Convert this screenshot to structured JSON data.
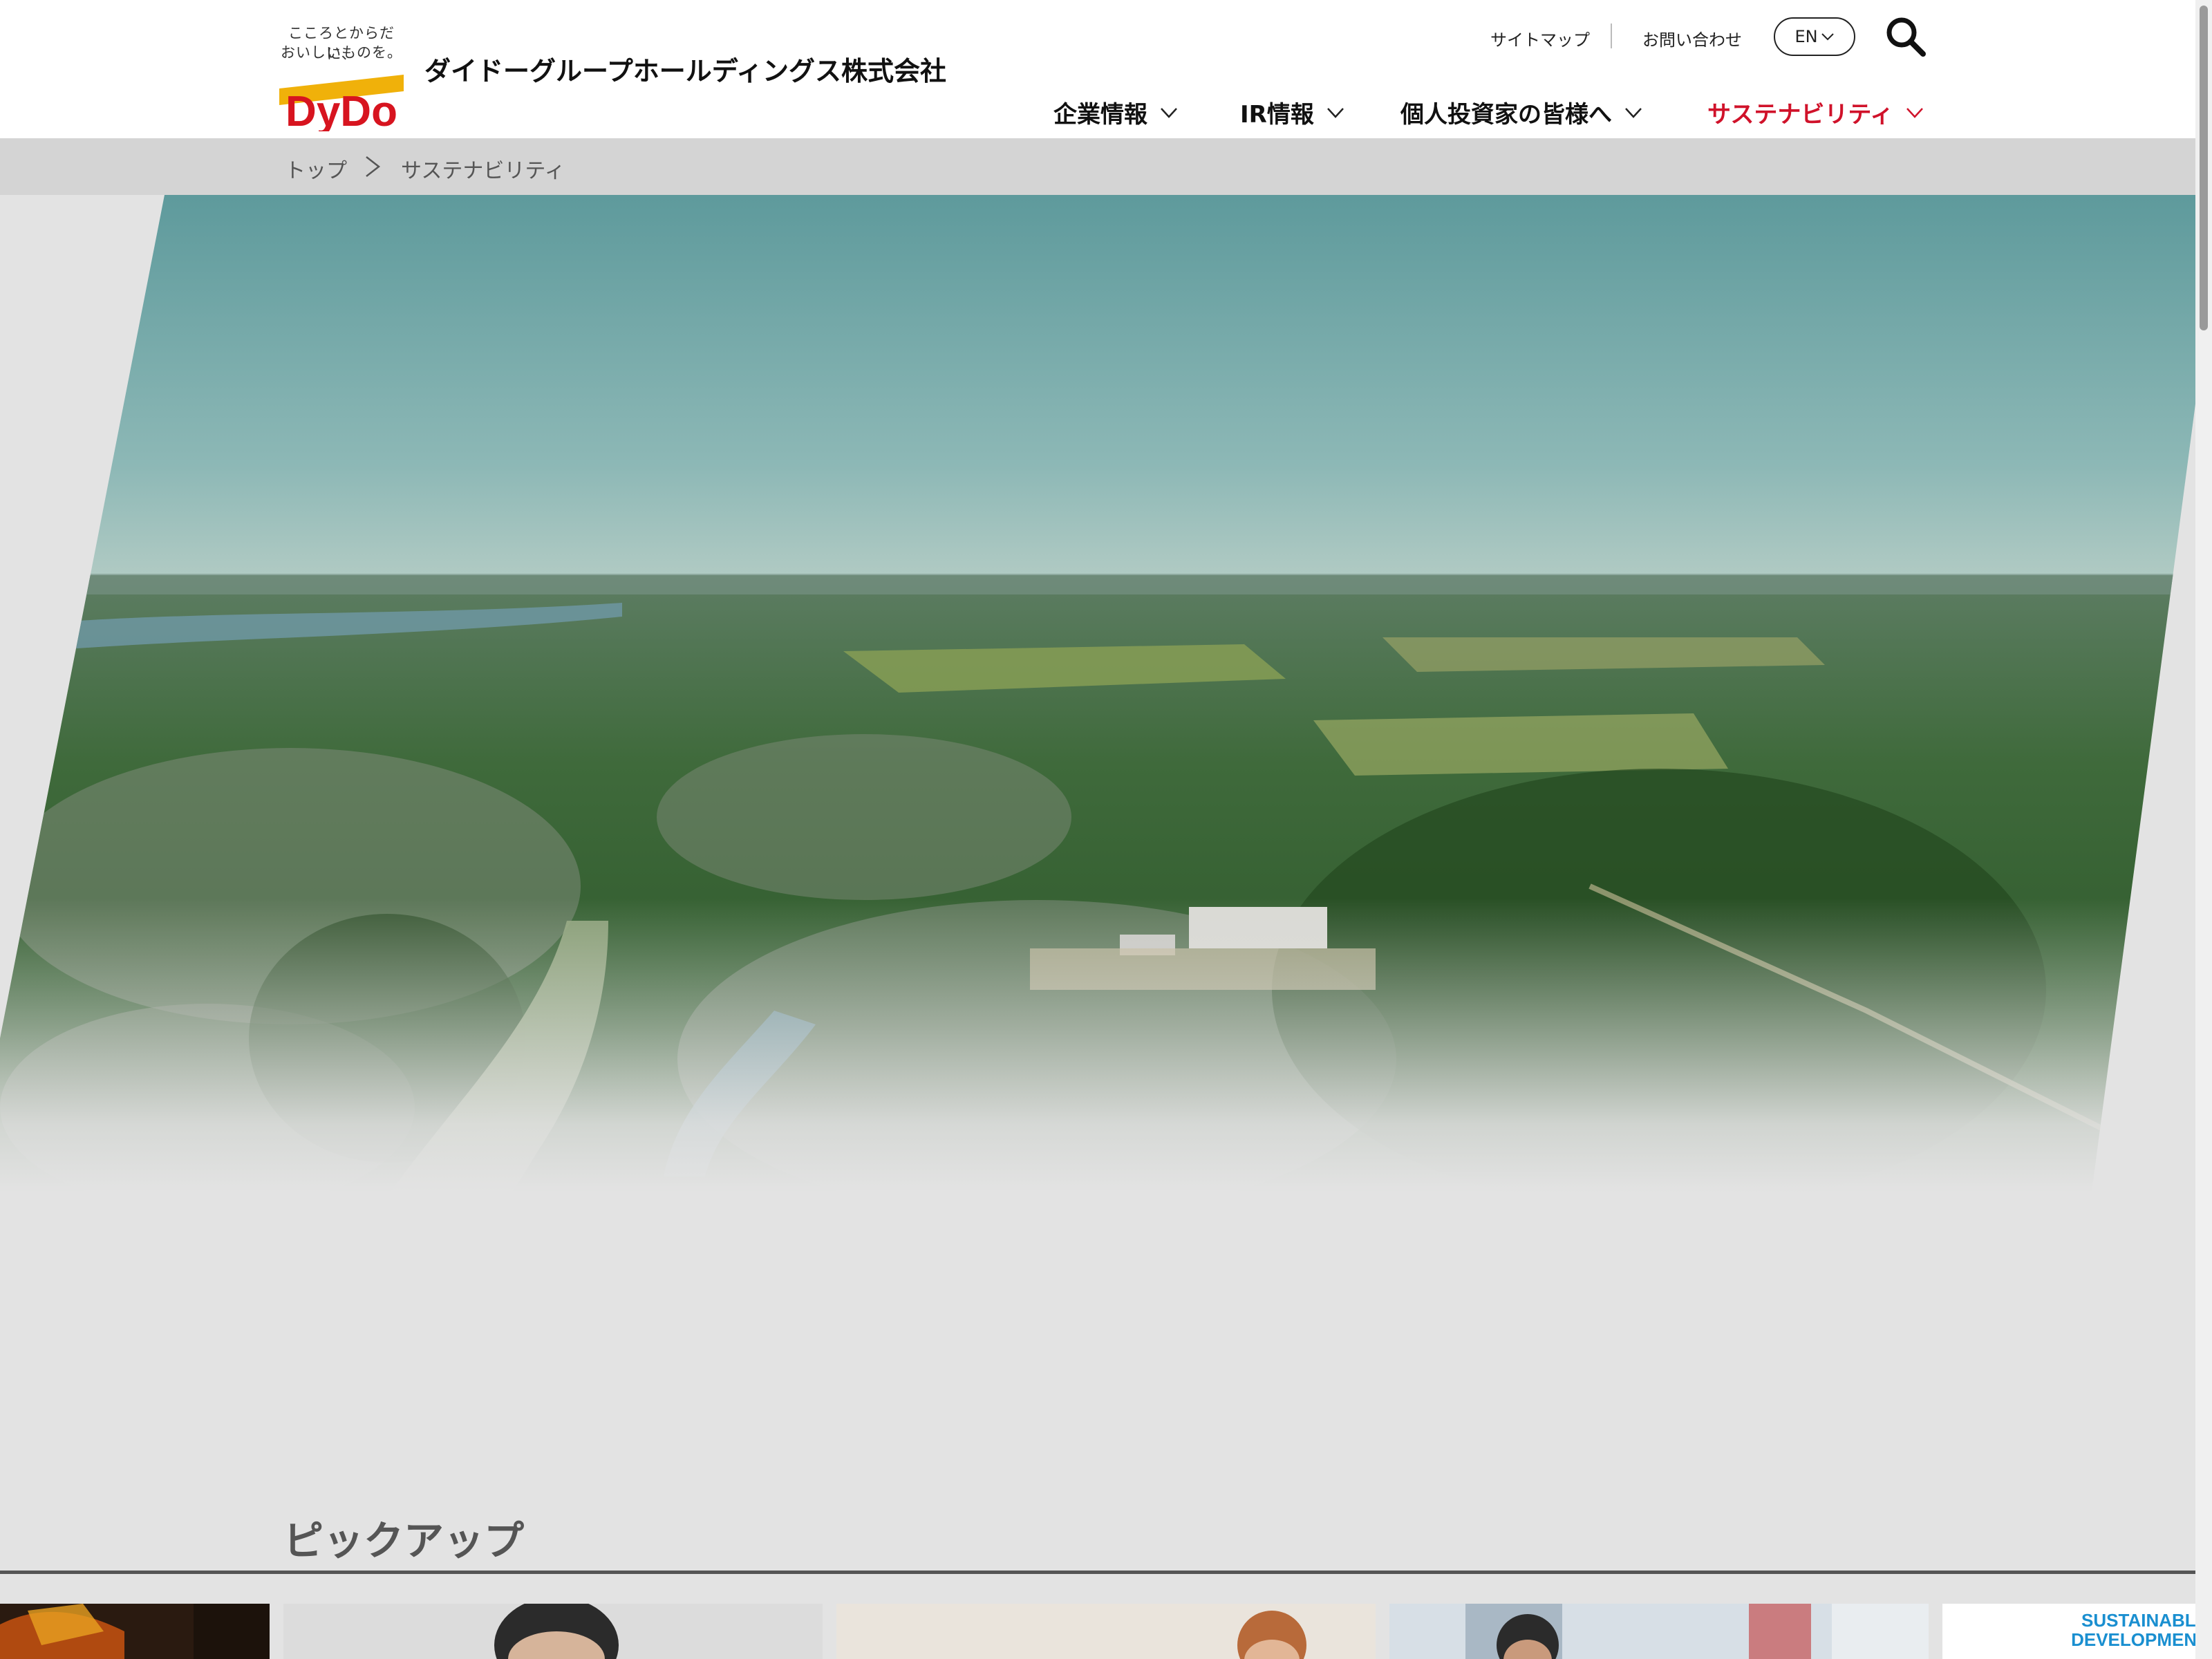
{
  "header": {
    "logo": {
      "tagline_line1": "こころとからだに、",
      "tagline_line2": "おいしいものを。",
      "wordmark": "DyDo"
    },
    "company_name": "ダイドーグループホールディングス株式会社",
    "utility": {
      "sitemap": "サイトマップ",
      "contact": "お問い合わせ",
      "language": "EN"
    },
    "nav": [
      {
        "label": "企業情報",
        "active": false
      },
      {
        "label": "IR情報",
        "active": false
      },
      {
        "label": "個人投資家の皆様へ",
        "active": false
      },
      {
        "label": "サステナビリティ",
        "active": true
      }
    ]
  },
  "breadcrumb": {
    "items": [
      "トップ",
      "サステナビリティ"
    ]
  },
  "pickup": {
    "title": "ピックアップ",
    "cards": [
      {
        "image": "dark-event-photo"
      },
      {
        "image": "person-portrait"
      },
      {
        "image": "person-portrait"
      },
      {
        "image": "person-with-city-building"
      },
      {
        "image": "sdgs-logo",
        "text_line1": "SUSTAINABLE",
        "text_line2": "DEVELOPMENT"
      }
    ]
  },
  "colors": {
    "accent_red": "#d0122a",
    "logo_red": "#d7141f",
    "logo_yellow": "#f0b10a",
    "sdg_blue": "#1a8fd0"
  },
  "icons": {
    "search": "search-icon",
    "chevron": "chevron-down-icon",
    "breadcrumb_separator": "chevron-right-icon"
  }
}
